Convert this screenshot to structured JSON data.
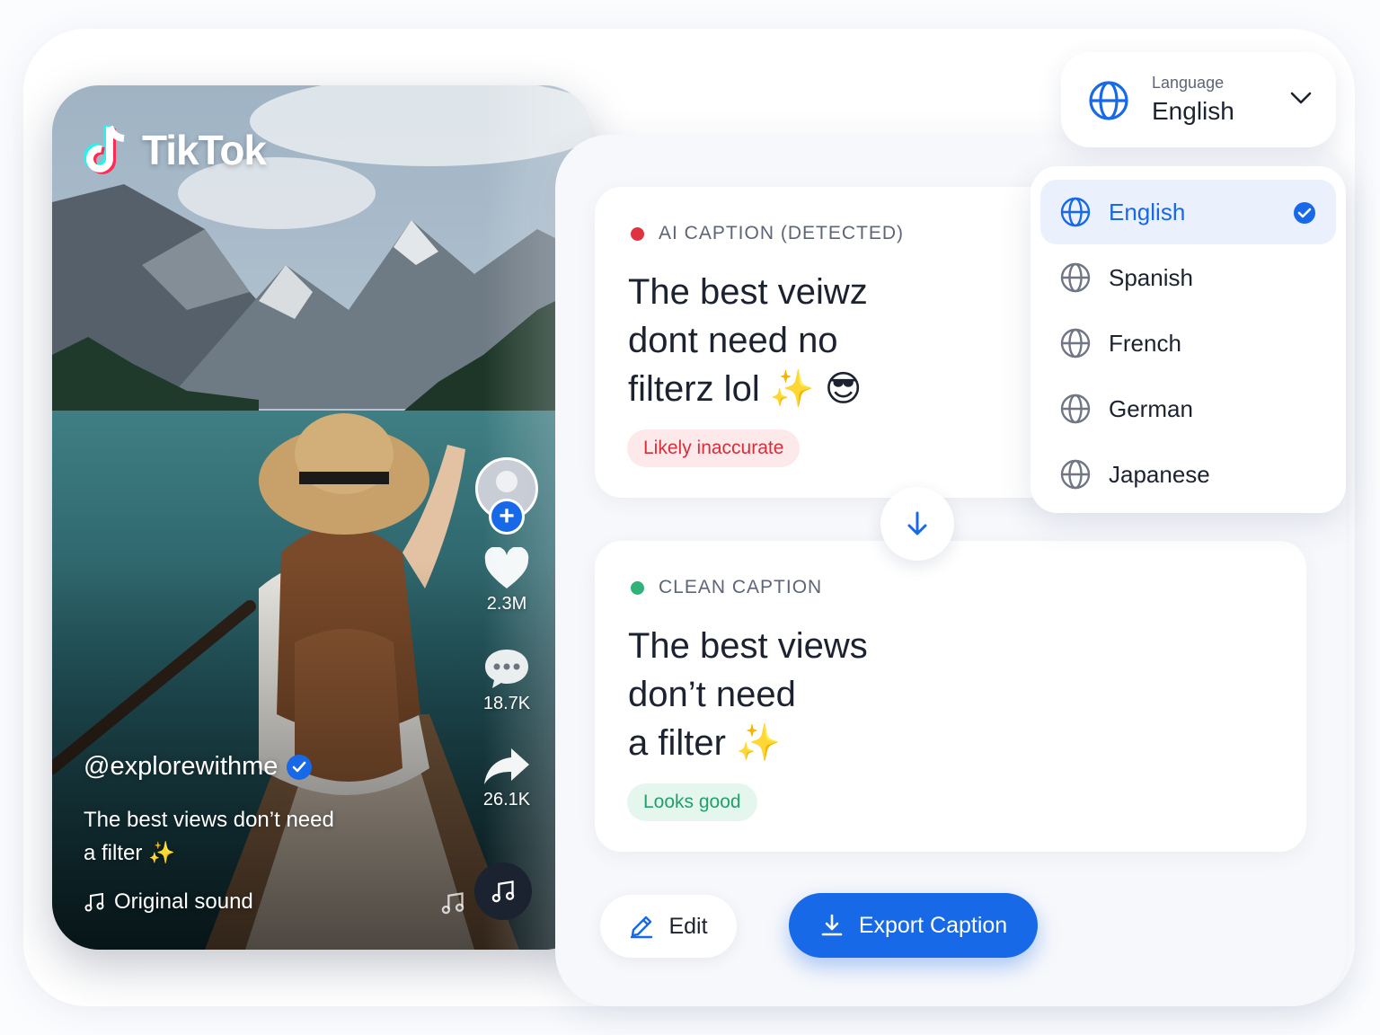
{
  "app": {
    "name": "TikTok"
  },
  "video": {
    "username": "@explorewithme",
    "caption": "The best views don’t need a filter ✨",
    "sound": "Original sound",
    "likes": "2.3M",
    "comments": "18.7K",
    "shares": "26.1K"
  },
  "language_selector": {
    "label": "Language",
    "value": "English",
    "options": [
      {
        "name": "English",
        "selected": true
      },
      {
        "name": "Spanish",
        "selected": false
      },
      {
        "name": "French",
        "selected": false
      },
      {
        "name": "German",
        "selected": false
      },
      {
        "name": "Japanese",
        "selected": false
      }
    ]
  },
  "ai_caption": {
    "heading": "AI CAPTION (DETECTED)",
    "lines": [
      "The best veiwz",
      "dont need no",
      "filterz lol ✨ 😎"
    ],
    "badge": "Likely inaccurate"
  },
  "clean_caption": {
    "heading": "CLEAN CAPTION",
    "lines": [
      "The best views",
      "don’t need",
      "a filter ✨"
    ],
    "badge": "Looks good"
  },
  "actions": {
    "edit_label": "Edit",
    "export_label": "Export Caption"
  },
  "colors": {
    "accent": "#1769e8",
    "error": "#e0323f",
    "success": "#2fb37b"
  }
}
